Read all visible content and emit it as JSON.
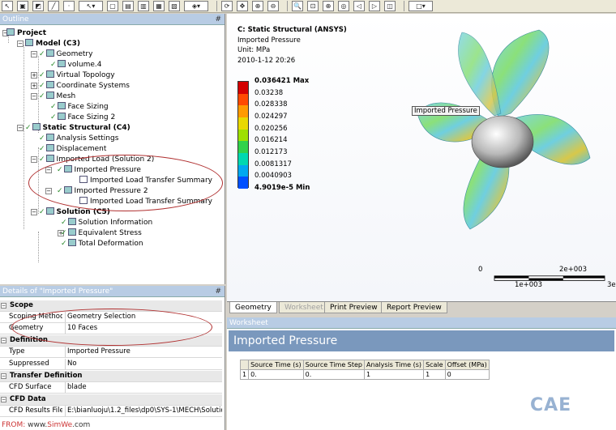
{
  "toolbar": {
    "icons": [
      "select-pointer",
      "select-body",
      "select-face",
      "select-edge",
      "select-vertex",
      "select-arrow",
      "box-select",
      "body-select",
      "face-select",
      "edge-select",
      "vertex-select",
      "geometry-dropdown",
      "rotate",
      "pan",
      "zoom-in",
      "zoom-out",
      "zoom-box",
      "zoom-fit",
      "magnify",
      "previous-view",
      "next-view",
      "isometric",
      "graphics-dropdown"
    ]
  },
  "outline": {
    "title": "Outline",
    "pin": "#",
    "items": [
      {
        "label": "Project"
      },
      {
        "label": "Model (C3)"
      },
      {
        "label": "Geometry"
      },
      {
        "label": "volume.4"
      },
      {
        "label": "Virtual Topology"
      },
      {
        "label": "Coordinate Systems"
      },
      {
        "label": "Mesh"
      },
      {
        "label": "Face Sizing"
      },
      {
        "label": "Face Sizing 2"
      },
      {
        "label": "Static Structural (C4)"
      },
      {
        "label": "Analysis Settings"
      },
      {
        "label": "Displacement"
      },
      {
        "label": "Imported Load (Solution 2)"
      },
      {
        "label": "Imported Pressure"
      },
      {
        "label": "Imported Load Transfer Summary"
      },
      {
        "label": "Imported Pressure 2"
      },
      {
        "label": "Imported Load Transfer Summary"
      },
      {
        "label": "Solution (C5)"
      },
      {
        "label": "Solution Information"
      },
      {
        "label": "Equivalent Stress"
      },
      {
        "label": "Total Deformation"
      }
    ]
  },
  "details": {
    "title": "Details of \"Imported Pressure\"",
    "pin": "#",
    "rows": [
      {
        "section": "Scope"
      },
      {
        "key": "Scoping Method",
        "value": "Geometry Selection"
      },
      {
        "key": "Geometry",
        "value": "10 Faces"
      },
      {
        "section": "Definition"
      },
      {
        "key": "Type",
        "value": "Imported Pressure"
      },
      {
        "key": "Suppressed",
        "value": "No"
      },
      {
        "section": "Transfer Definition"
      },
      {
        "key": "CFD Surface",
        "value": "blade"
      },
      {
        "section": "CFD Data"
      },
      {
        "key": "CFD Results File",
        "value": "E:\\bianluoju\\1.2_files\\dp0\\SYS-1\\MECH\\Solutio..."
      }
    ]
  },
  "viewport": {
    "title": "C: Static Structural (ANSYS)",
    "subtitle": "Imported Pressure",
    "unit": "Unit: MPa",
    "date": "2010-1-12 20:26",
    "legend": [
      {
        "label": "0.036421 Max",
        "color": "#d40000"
      },
      {
        "label": "0.03238",
        "color": "#ff4a00"
      },
      {
        "label": "0.028338",
        "color": "#ff9a00"
      },
      {
        "label": "0.024297",
        "color": "#e8d800"
      },
      {
        "label": "0.020256",
        "color": "#9ee000"
      },
      {
        "label": "0.016214",
        "color": "#30d24a"
      },
      {
        "label": "0.012173",
        "color": "#00d8b0"
      },
      {
        "label": "0.0081317",
        "color": "#00a8f0"
      },
      {
        "label": "0.0040903",
        "color": "#0050ff"
      },
      {
        "label": "4.9019e-5 Min",
        "color": "#0000b8"
      }
    ],
    "callout": "Imported Pressure",
    "scale": {
      "t0": "0",
      "t1": "1e+003",
      "t2": "2e+003",
      "t3": "3e"
    }
  },
  "tabs": [
    "Geometry",
    "Worksheet",
    "Print Preview",
    "Report Preview"
  ],
  "worksheet": {
    "title": "Worksheet",
    "heading": "Imported Pressure",
    "columns": [
      "Source Time (s)",
      "Source Time Step",
      "Analysis Time (s)",
      "Scale",
      "Offset (MPa)"
    ],
    "rows": [
      [
        "1",
        "0.",
        "0.",
        "1",
        "1",
        "0"
      ]
    ]
  },
  "footer": {
    "prefix": "FROM:",
    "text": " www.",
    "brand": "SimWe",
    "suffix": ".com"
  },
  "watermark": "CAE"
}
